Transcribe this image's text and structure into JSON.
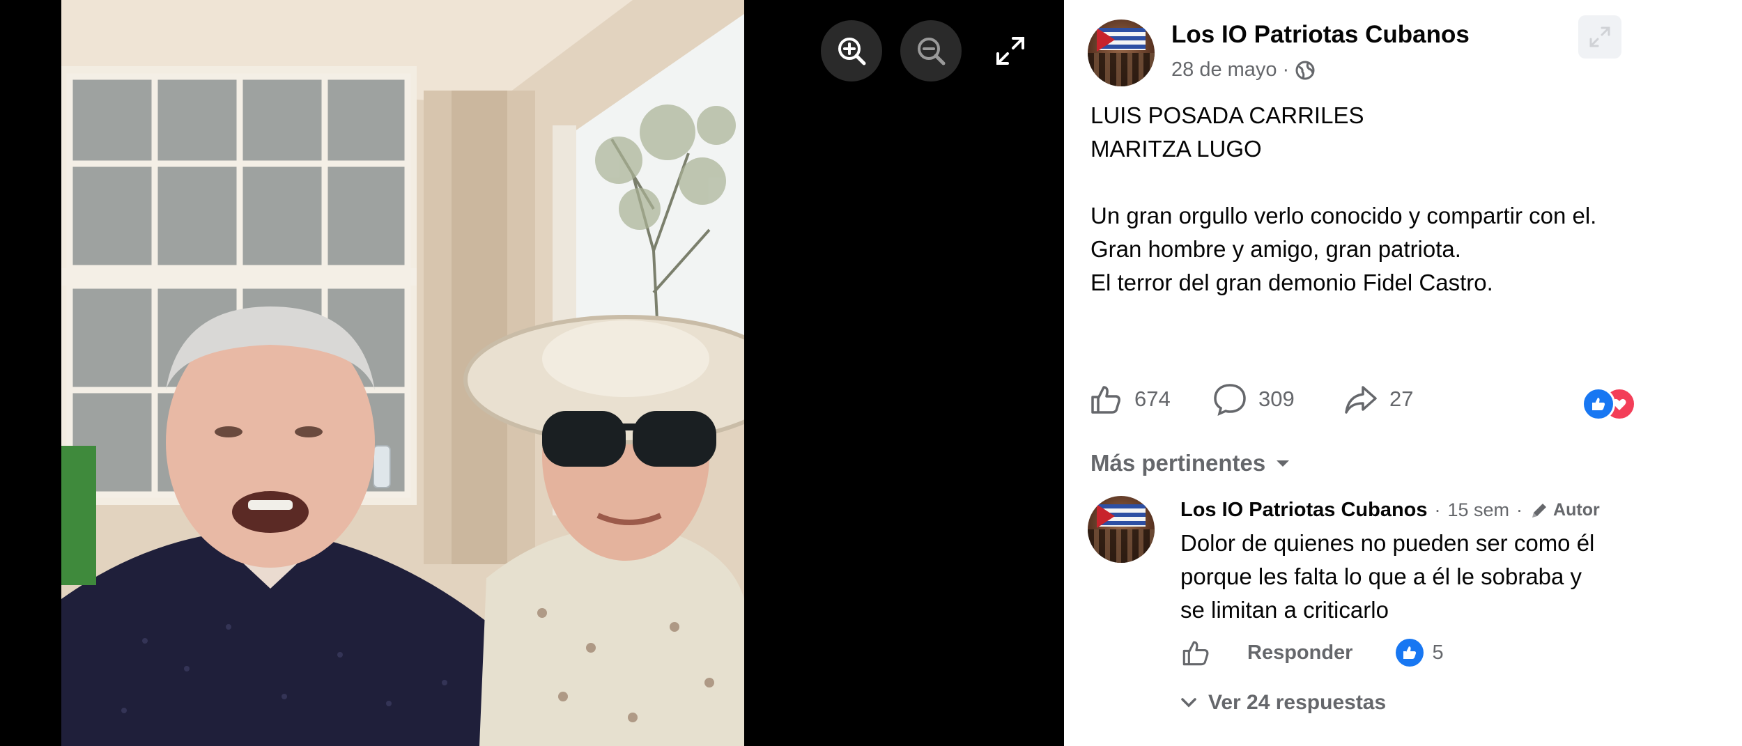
{
  "viewer": {
    "zoom_in_label": "Zoom in",
    "zoom_out_label": "Zoom out",
    "fullscreen_label": "Full screen"
  },
  "post": {
    "page_name": "Los IO Patriotas Cubanos",
    "date": "28 de mayo",
    "separator": "·",
    "text_lines": [
      "LUIS POSADA CARRILES",
      "MARITZA LUGO",
      "",
      "Un gran orgullo verlo conocido y compartir con el.",
      "Gran hombre y amigo, gran patriota.",
      "El terror del gran demonio Fidel Castro."
    ],
    "likes": "674",
    "comments": "309",
    "shares": "27"
  },
  "comments_section": {
    "sort_label": "Más pertinentes",
    "comment": {
      "author": "Los IO Patriotas Cubanos",
      "age": "15 sem",
      "author_badge": "Autor",
      "text": "Dolor de quienes no pueden ser como él porque les falta lo que a él le sobraba y se limitan a criticarlo",
      "reply_label": "Responder",
      "like_count": "5"
    },
    "view_replies": "Ver 24 respuestas"
  },
  "colors": {
    "facebook_blue": "#1877f2",
    "love_red": "#f33e58",
    "secondary_text": "#65676b"
  }
}
